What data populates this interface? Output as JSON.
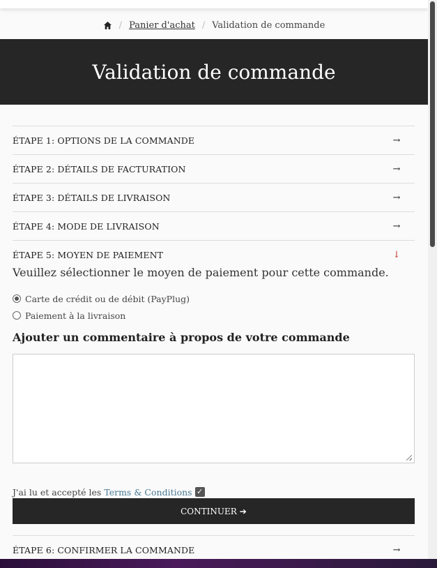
{
  "breadcrumb": {
    "home_icon": "home-icon",
    "cart": "Panier d'achat",
    "current": "Validation de commande"
  },
  "hero": {
    "title": "Validation de commande"
  },
  "steps": [
    {
      "label": "ÉTAPE 1: OPTIONS DE LA COMMANDE",
      "icon": "arrow-right-icon"
    },
    {
      "label": "ÉTAPE 2: DÉTAILS DE FACTURATION",
      "icon": "arrow-right-icon"
    },
    {
      "label": "ÉTAPE 3: DÉTAILS DE LIVRAISON",
      "icon": "arrow-right-icon"
    },
    {
      "label": "ÉTAPE 4: MODE DE LIVRAISON",
      "icon": "arrow-right-icon"
    },
    {
      "label": "ÉTAPE 5: MOYEN DE PAIEMENT",
      "icon": "arrow-down-icon"
    }
  ],
  "payment": {
    "intro": "Veuillez sélectionner le moyen de paiement pour cette commande.",
    "options": [
      {
        "label": "Carte de crédit ou de débit (PayPlug)",
        "selected": true
      },
      {
        "label": "Paiement à la livraison",
        "selected": false
      }
    ]
  },
  "comment": {
    "title": "Ajouter un commentaire à propos de votre commande",
    "value": ""
  },
  "terms": {
    "prefix": "J'ai lu et accepté les",
    "link": "Terms & Conditions",
    "checked": true
  },
  "continue_label": "CONTINUER",
  "step6": {
    "label": "ÉTAPE 6: CONFIRMER LA COMMANDE",
    "icon": "arrow-right-icon"
  },
  "colors": {
    "dark": "#262626",
    "link": "#4a7a94",
    "accent": "#c0392b"
  }
}
